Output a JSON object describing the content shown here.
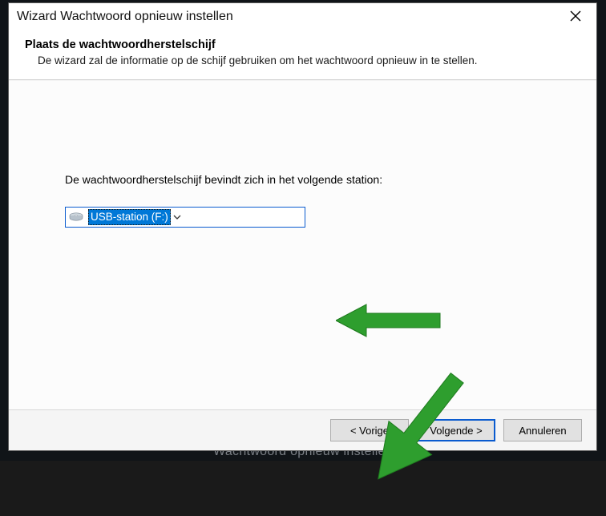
{
  "dialog": {
    "title": "Wizard Wachtwoord opnieuw instellen",
    "heading": "Plaats de wachtwoordherstelschijf",
    "subheading": "De wizard zal de informatie op de schijf gebruiken om het wachtwoord opnieuw in te stellen.",
    "prompt": "De wachtwoordherstelschijf bevindt zich in het volgende station:",
    "drive_combo": {
      "selected": "USB-station (F:)"
    },
    "buttons": {
      "back": "< Vorige",
      "next": "Volgende >",
      "cancel": "Annuleren"
    }
  },
  "background_caption": "Wachtwoord opnieuw instellen"
}
